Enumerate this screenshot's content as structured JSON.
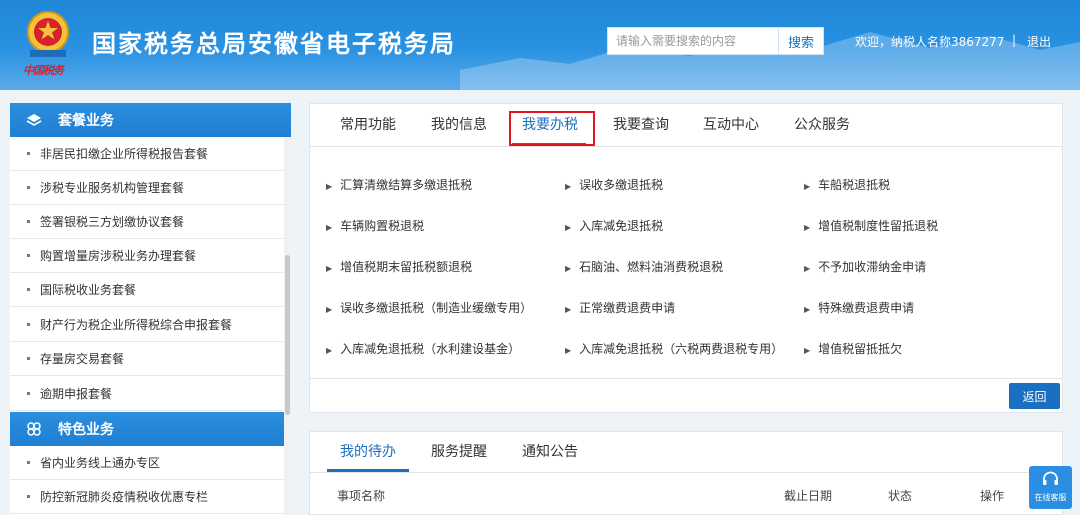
{
  "header": {
    "emblem_text": "中国税务",
    "title": "国家税务总局安徽省电子税务局",
    "search_placeholder": "请输入需要搜索的内容",
    "search_button": "搜索",
    "welcome": "欢迎，纳税人名称3867277",
    "separator": "|",
    "logout": "退出"
  },
  "sidebar": {
    "group1": {
      "title": "套餐业务",
      "icon": "layers-icon",
      "items": [
        "非居民扣缴企业所得税报告套餐",
        "涉税专业服务机构管理套餐",
        "签署银税三方划缴协议套餐",
        "购置增量房涉税业务办理套餐",
        "国际税收业务套餐",
        "财产行为税企业所得税综合申报套餐",
        "存量房交易套餐",
        "逾期申报套餐"
      ]
    },
    "group2": {
      "title": "特色业务",
      "icon": "clover-icon",
      "items": [
        "省内业务线上通办专区",
        "防控新冠肺炎疫情税收优惠专栏"
      ]
    }
  },
  "main": {
    "tabs": [
      "常用功能",
      "我的信息",
      "我要办税",
      "我要查询",
      "互动中心",
      "公众服务"
    ],
    "active_tab": "我要办税",
    "functions": [
      [
        "汇算清缴结算多缴退抵税",
        "误收多缴退抵税",
        "车船税退抵税"
      ],
      [
        "车辆购置税退税",
        "入库减免退抵税",
        "增值税制度性留抵退税"
      ],
      [
        "增值税期末留抵税额退税",
        "石脑油、燃料油消费税退税",
        "不予加收滞纳金申请"
      ],
      [
        "误收多缴退抵税（制造业缓缴专用）",
        "正常缴费退费申请",
        "特殊缴费退费申请"
      ],
      [
        "入库减免退抵税（水利建设基金）",
        "入库减免退抵税（六税两费退税专用）",
        "增值税留抵抵欠"
      ]
    ],
    "back_button": "返回"
  },
  "todo": {
    "tabs": [
      "我的待办",
      "服务提醒",
      "通知公告"
    ],
    "active_tab": "我的待办",
    "columns": [
      "事项名称",
      "截止日期",
      "状态",
      "操作"
    ]
  },
  "online_service": {
    "label": "在线客服",
    "icon": "headset-icon"
  },
  "colors": {
    "primary": "#1b6fc0",
    "header": "#2a92e2",
    "highlight": "#e0161f"
  }
}
